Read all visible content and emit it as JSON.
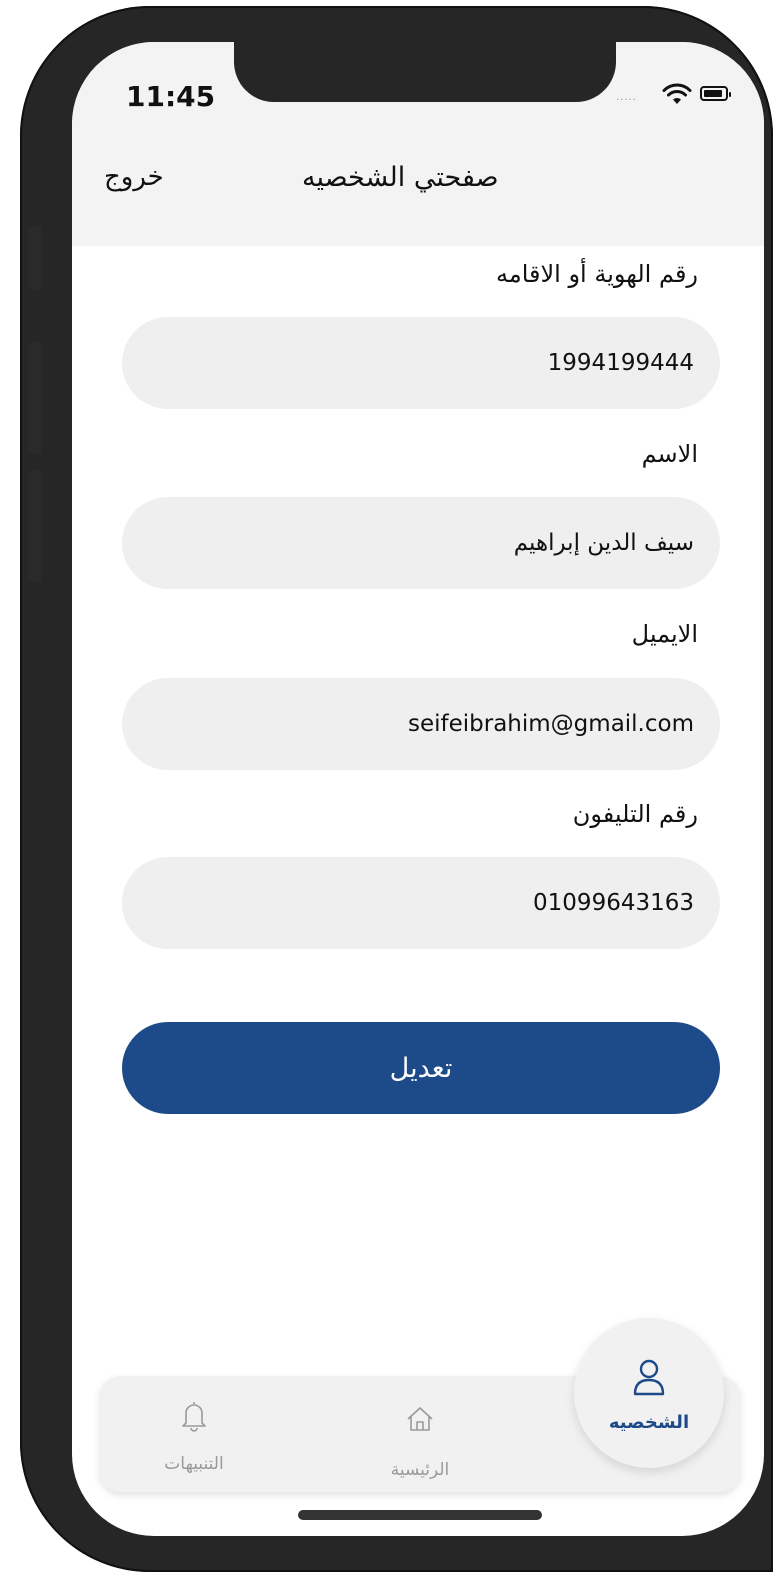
{
  "status_bar": {
    "time": "11:45",
    "signal_text": "....."
  },
  "nav": {
    "title": "صفحتي الشخصيه",
    "exit_label": "خروج"
  },
  "form": {
    "id_label": "رقم الهوية أو الاقامه",
    "id_value": "1994199444",
    "name_label": "الاسم",
    "name_value": "سيف الدين إبراهيم",
    "email_label": "الايميل",
    "email_value": "seifeibrahim@gmail.com",
    "phone_label": "رقم التليفون",
    "phone_value": "01099643163"
  },
  "edit_button_label": "تعديل",
  "tabs": {
    "notifications": {
      "label": "التنبيهات",
      "icon": "bell-icon"
    },
    "home": {
      "label": "الرئيسية",
      "icon": "home-icon"
    },
    "profile": {
      "label": "الشخصيه",
      "icon": "user-icon",
      "active": true
    }
  },
  "colors": {
    "accent": "#1d4a88",
    "field_bg": "#efefef",
    "tab_inactive": "#9a9a9a"
  }
}
